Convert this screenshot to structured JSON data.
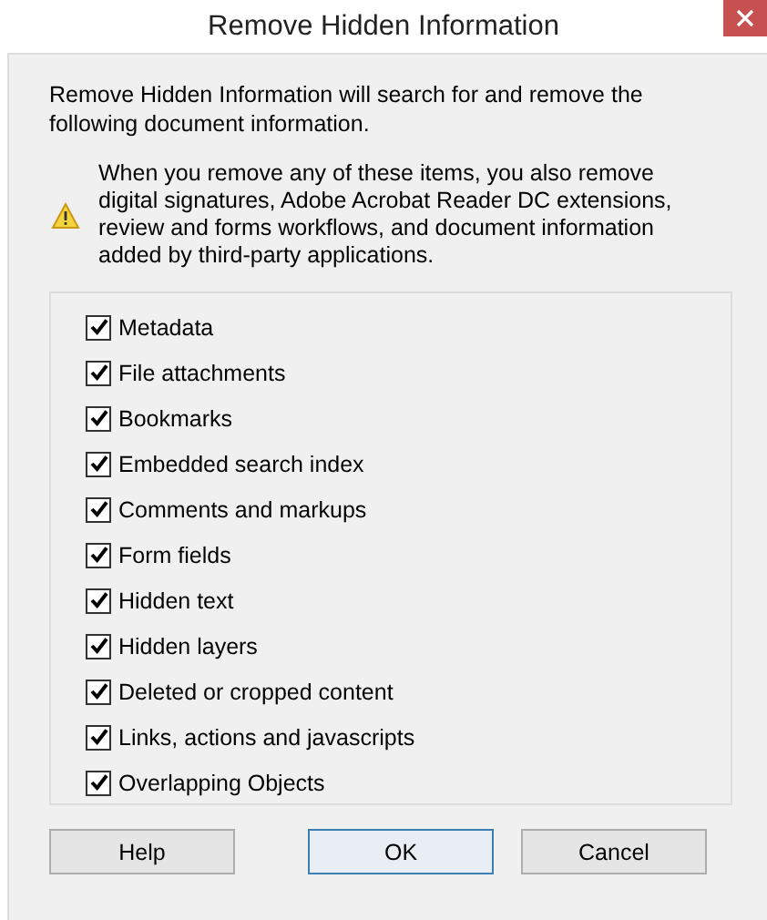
{
  "window": {
    "title": "Remove Hidden Information"
  },
  "intro": "Remove Hidden Information will search for and remove the following document information.",
  "warning": "When you remove any of these items, you also remove digital signatures, Adobe Acrobat Reader DC extensions, review and forms workflows, and document information added by third-party applications.",
  "items": [
    {
      "label": "Metadata",
      "checked": true
    },
    {
      "label": "File attachments",
      "checked": true
    },
    {
      "label": "Bookmarks",
      "checked": true
    },
    {
      "label": "Embedded search index",
      "checked": true
    },
    {
      "label": "Comments and markups",
      "checked": true
    },
    {
      "label": "Form fields",
      "checked": true
    },
    {
      "label": "Hidden text",
      "checked": true
    },
    {
      "label": "Hidden layers",
      "checked": true
    },
    {
      "label": "Deleted or cropped content",
      "checked": true
    },
    {
      "label": "Links, actions and javascripts",
      "checked": true
    },
    {
      "label": "Overlapping Objects",
      "checked": true
    }
  ],
  "buttons": [
    {
      "label": "Help",
      "default": false
    },
    {
      "label": "OK",
      "default": true
    },
    {
      "label": "Cancel",
      "default": false
    }
  ]
}
